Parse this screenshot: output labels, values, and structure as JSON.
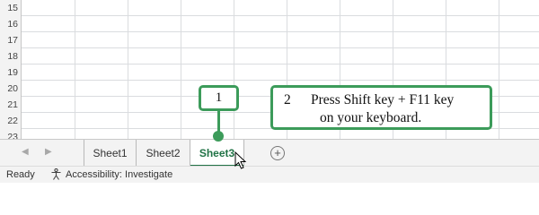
{
  "grid": {
    "row_numbers": [
      "15",
      "16",
      "17",
      "18",
      "19",
      "20",
      "21",
      "22",
      "23"
    ]
  },
  "sheet_tabs": {
    "nav_prev_icon": "triangle-left",
    "nav_next_icon": "triangle-right",
    "tabs": [
      {
        "label": "Sheet1",
        "active": false
      },
      {
        "label": "Sheet2",
        "active": false
      },
      {
        "label": "Sheet3",
        "active": true
      }
    ],
    "add_icon": "plus-circle"
  },
  "status_bar": {
    "ready": "Ready",
    "accessibility": "Accessibility: Investigate"
  },
  "callouts": {
    "step1": {
      "number": "1"
    },
    "step2": {
      "number": "2",
      "line1": "Press Shift key + F11 key",
      "line2": "on your keyboard."
    },
    "accent_color": "#3c9b5a"
  },
  "colors": {
    "active_tab_text": "#217346",
    "tab_bar_bg": "#f3f3f3",
    "gridline": "#dadcdf"
  }
}
